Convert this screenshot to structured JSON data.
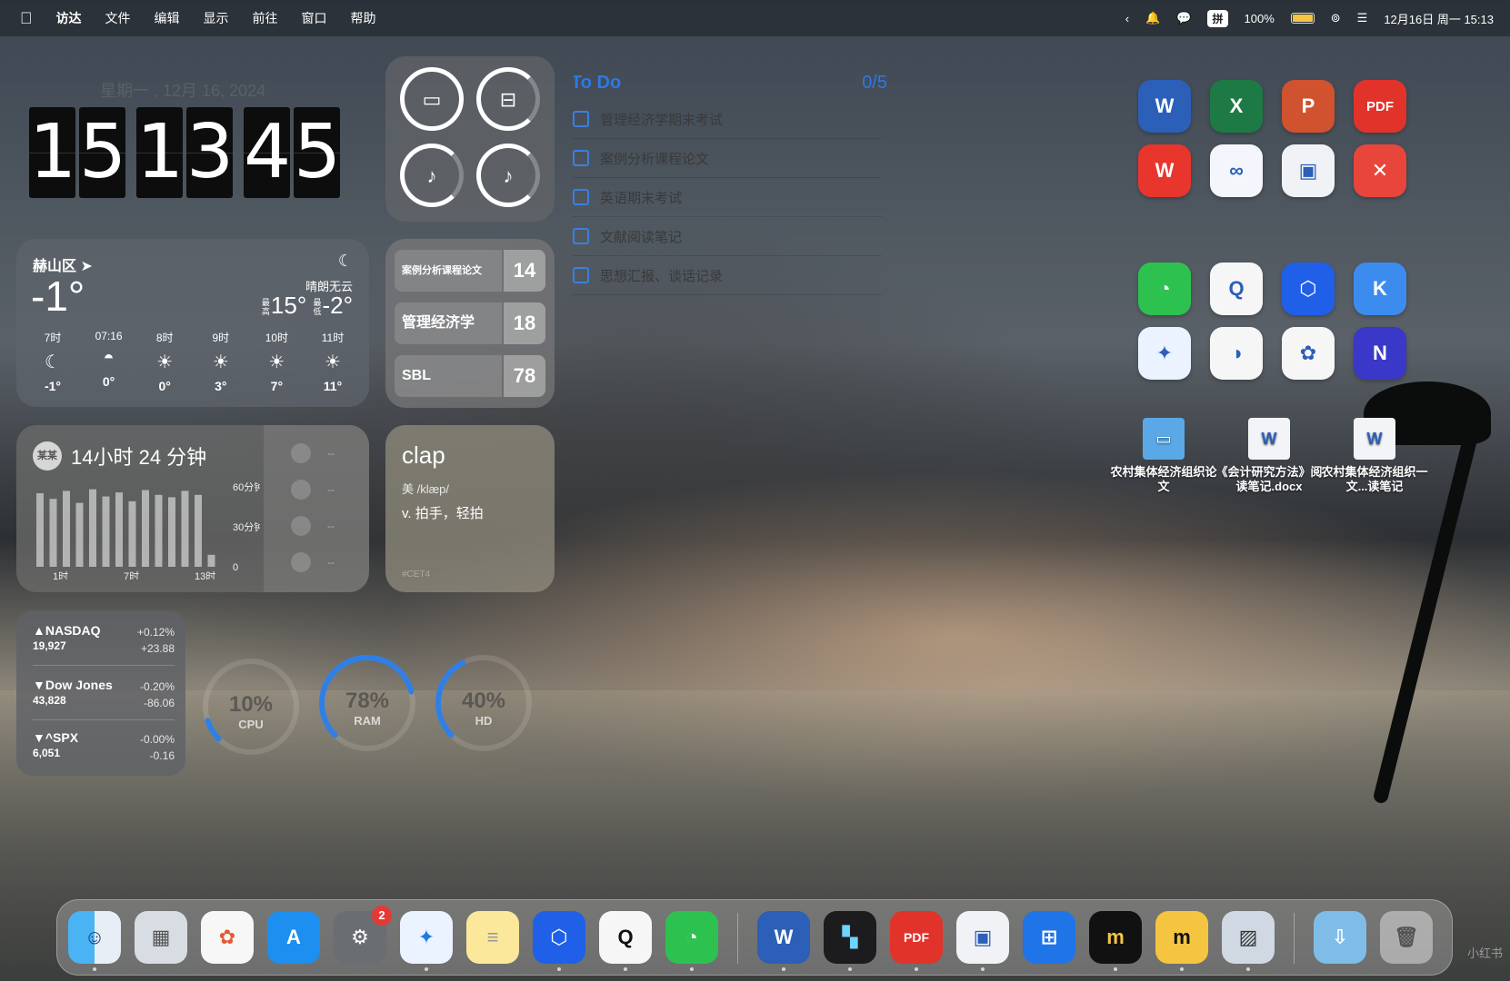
{
  "menubar": {
    "app_name": "访达",
    "menus": [
      "文件",
      "编辑",
      "显示",
      "前往",
      "窗口",
      "帮助"
    ],
    "ime_label": "拼",
    "battery_percent": "100%",
    "battery_level": 1.0,
    "datetime": "12月16日 周一 15:13"
  },
  "clock_widget": {
    "date": "星期一 , 12月 16, 2024",
    "digits": [
      "1",
      "5",
      "1",
      "3",
      "4",
      "5"
    ]
  },
  "weather": {
    "city": "赫山区",
    "temperature": "-1°",
    "condition": "晴朗无云",
    "high_label": "最高",
    "high": "15°",
    "low_label": "最低",
    "low": "-2°",
    "hours": [
      {
        "time": "7时",
        "icon": "moon-icon",
        "temp": "-1°"
      },
      {
        "time": "07:16",
        "icon": "sunrise-icon",
        "temp": "0°"
      },
      {
        "time": "8时",
        "icon": "sun-icon",
        "temp": "0°"
      },
      {
        "time": "9时",
        "icon": "sun-icon",
        "temp": "3°"
      },
      {
        "time": "10时",
        "icon": "sun-icon",
        "temp": "7°"
      },
      {
        "time": "11时",
        "icon": "sun-icon",
        "temp": "11°"
      }
    ]
  },
  "screen_time": {
    "avatar": "某某",
    "total": "14小时 24 分钟",
    "y_labels": [
      "60分钟",
      "30分钟",
      "0"
    ],
    "x_labels": [
      "1时",
      "7时",
      "13时"
    ],
    "side_values": [
      "--",
      "--",
      "--",
      "--"
    ]
  },
  "stocks": [
    {
      "name": "▲NASDAQ",
      "value": "19,927",
      "pct": "+0.12%",
      "change": "+23.88"
    },
    {
      "name": "▼Dow Jones",
      "value": "43,828",
      "pct": "-0.20%",
      "change": "-86.06"
    },
    {
      "name": "▼^SPX",
      "value": "6,051",
      "pct": "-0.00%",
      "change": "-0.16"
    }
  ],
  "device_batteries": {
    "devices": [
      "laptop-icon",
      "airpods-case-icon",
      "airpod-left-icon",
      "airpod-right-icon"
    ]
  },
  "countdown": [
    {
      "name": "案例分析课程论文",
      "days": "14"
    },
    {
      "name": "管理经济学",
      "days": "18"
    },
    {
      "name": "SBL",
      "days": "78"
    }
  ],
  "word_card": {
    "word": "clap",
    "phonetic": "美 /klæp/",
    "definition": "v. 拍手，轻拍",
    "tag": "#CET4"
  },
  "system_monitor": [
    {
      "value": "10%",
      "label": "CPU",
      "fraction": 0.1
    },
    {
      "value": "78%",
      "label": "RAM",
      "fraction": 0.78
    },
    {
      "value": "40%",
      "label": "HD",
      "fraction": 0.4
    }
  ],
  "todo": {
    "title": "To Do",
    "count": "0/5",
    "items": [
      "管理经济学期末考试",
      "案例分析课程论文",
      "英语期末考试",
      "文献阅读笔记",
      "思想汇报、谈话记录"
    ]
  },
  "desktop_apps": {
    "row1": [
      {
        "name": "word-icon",
        "label": "W",
        "color": "#2b5fb8"
      },
      {
        "name": "excel-icon",
        "label": "X",
        "color": "#1e7a45"
      },
      {
        "name": "powerpoint-icon",
        "label": "P",
        "color": "#d0522f"
      },
      {
        "name": "pdf-expert-icon",
        "label": "PDF",
        "color": "#e2332b"
      }
    ],
    "row2": [
      {
        "name": "wps-icon",
        "label": "W",
        "color": "#e8362d"
      },
      {
        "name": "baidu-netdisk-icon",
        "label": "∞",
        "color": "#f4f6fb"
      },
      {
        "name": "remote-desktop-icon",
        "label": "▣",
        "color": "#f0f2f6"
      },
      {
        "name": "xmind-icon",
        "label": "✕",
        "color": "#e8463a"
      }
    ],
    "row3": [
      {
        "name": "wechat-icon",
        "label": "◔",
        "color": "#2dc24f"
      },
      {
        "name": "qq-icon",
        "label": "Q",
        "color": "#f6f6f6"
      },
      {
        "name": "lark-cube-icon",
        "label": "⬡",
        "color": "#2060e8"
      },
      {
        "name": "kimi-icon",
        "label": "K",
        "color": "#3c8cf0"
      }
    ],
    "row4": [
      {
        "name": "safari-icon",
        "label": "✦",
        "color": "#eaf3ff"
      },
      {
        "name": "quark-icon",
        "label": "◑",
        "color": "#f6f6f6"
      },
      {
        "name": "chatgpt-icon",
        "label": "✿",
        "color": "#f6f6f6"
      },
      {
        "name": "app-n-icon",
        "label": "N",
        "color": "#3a38c8"
      }
    ]
  },
  "desktop_files": [
    {
      "name": "folder-icon",
      "label": "农村集体经济组织论文"
    },
    {
      "name": "word-doc-icon",
      "label": "《会计研究方法》阅读笔记.docx"
    },
    {
      "name": "word-doc-icon",
      "label": "农村集体经济组织一文...读笔记"
    }
  ],
  "dock": {
    "apps": [
      "finder-icon",
      "launchpad-icon",
      "photos-icon",
      "app-store-icon",
      "system-settings-icon",
      "safari-icon",
      "notes-icon",
      "lark-cube-icon",
      "qq-icon",
      "wechat-icon"
    ],
    "settings_badge": "2",
    "docs": [
      "word-icon",
      "setapp-icon",
      "pdf-expert-icon",
      "remote-desktop-icon",
      "windows-app-icon",
      "marginnote-icon",
      "marginnote-huawei-icon",
      "preview-icon"
    ],
    "tail": [
      "downloads-folder-icon",
      "trash-icon"
    ],
    "watermark": "小红书"
  }
}
